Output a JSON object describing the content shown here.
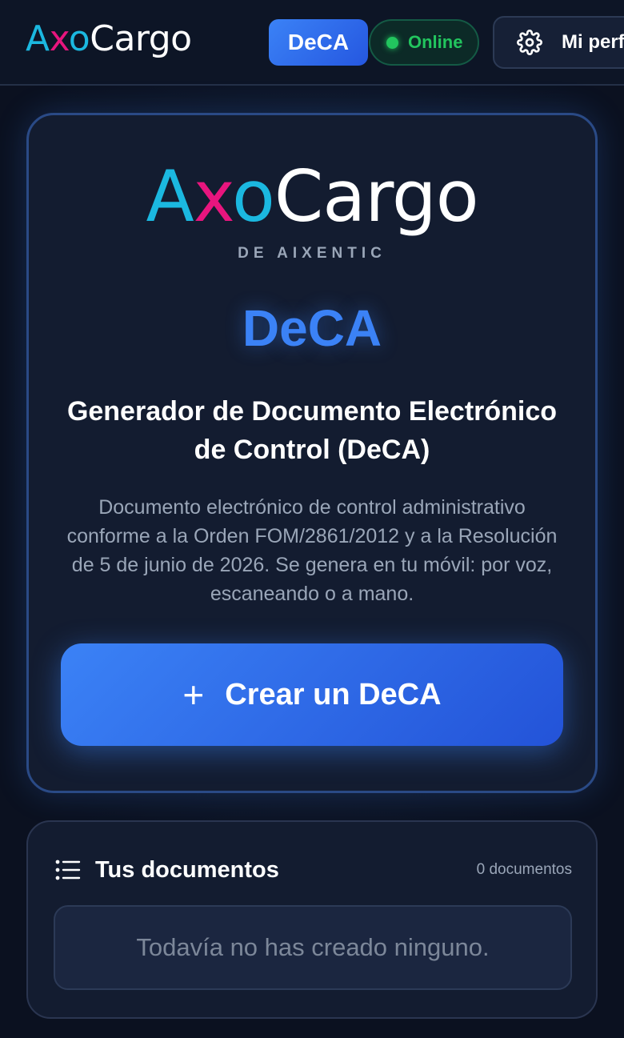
{
  "header": {
    "logo": {
      "part_a": "A",
      "part_x": "x",
      "part_o": "o",
      "part_cargo": "Cargo"
    },
    "badge_label": "DeCA",
    "status_label": "Online",
    "profile_label": "Mi perfil"
  },
  "hero": {
    "logo": {
      "part_a": "A",
      "part_x": "x",
      "part_o": "o",
      "part_cargo": "Cargo"
    },
    "subtitle": "DE AIXENTIC",
    "deca_label": "DeCA",
    "title": "Generador de Documento Electrónico de Control (DeCA)",
    "description": "Documento electrónico de control administrativo conforme a la Orden FOM/2861/2012 y a la Resolución de 5 de junio de 2026. Se genera en tu móvil: por voz, escaneando o a mano.",
    "cta_label": "Crear un DeCA"
  },
  "documents": {
    "title": "Tus documentos",
    "count_label": "0 documentos",
    "empty_message": "Todavía no has creado ninguno."
  },
  "icons": {
    "settings": "gear-icon",
    "add": "plus-icon",
    "list": "list-icon",
    "status": "status-dot-icon"
  },
  "colors": {
    "background": "#0b1120",
    "card": "#131c30",
    "accent_blue": "#3b82f6",
    "logo_cyan": "#1bb8e0",
    "logo_magenta": "#e8157e",
    "online_green": "#22c55e"
  }
}
